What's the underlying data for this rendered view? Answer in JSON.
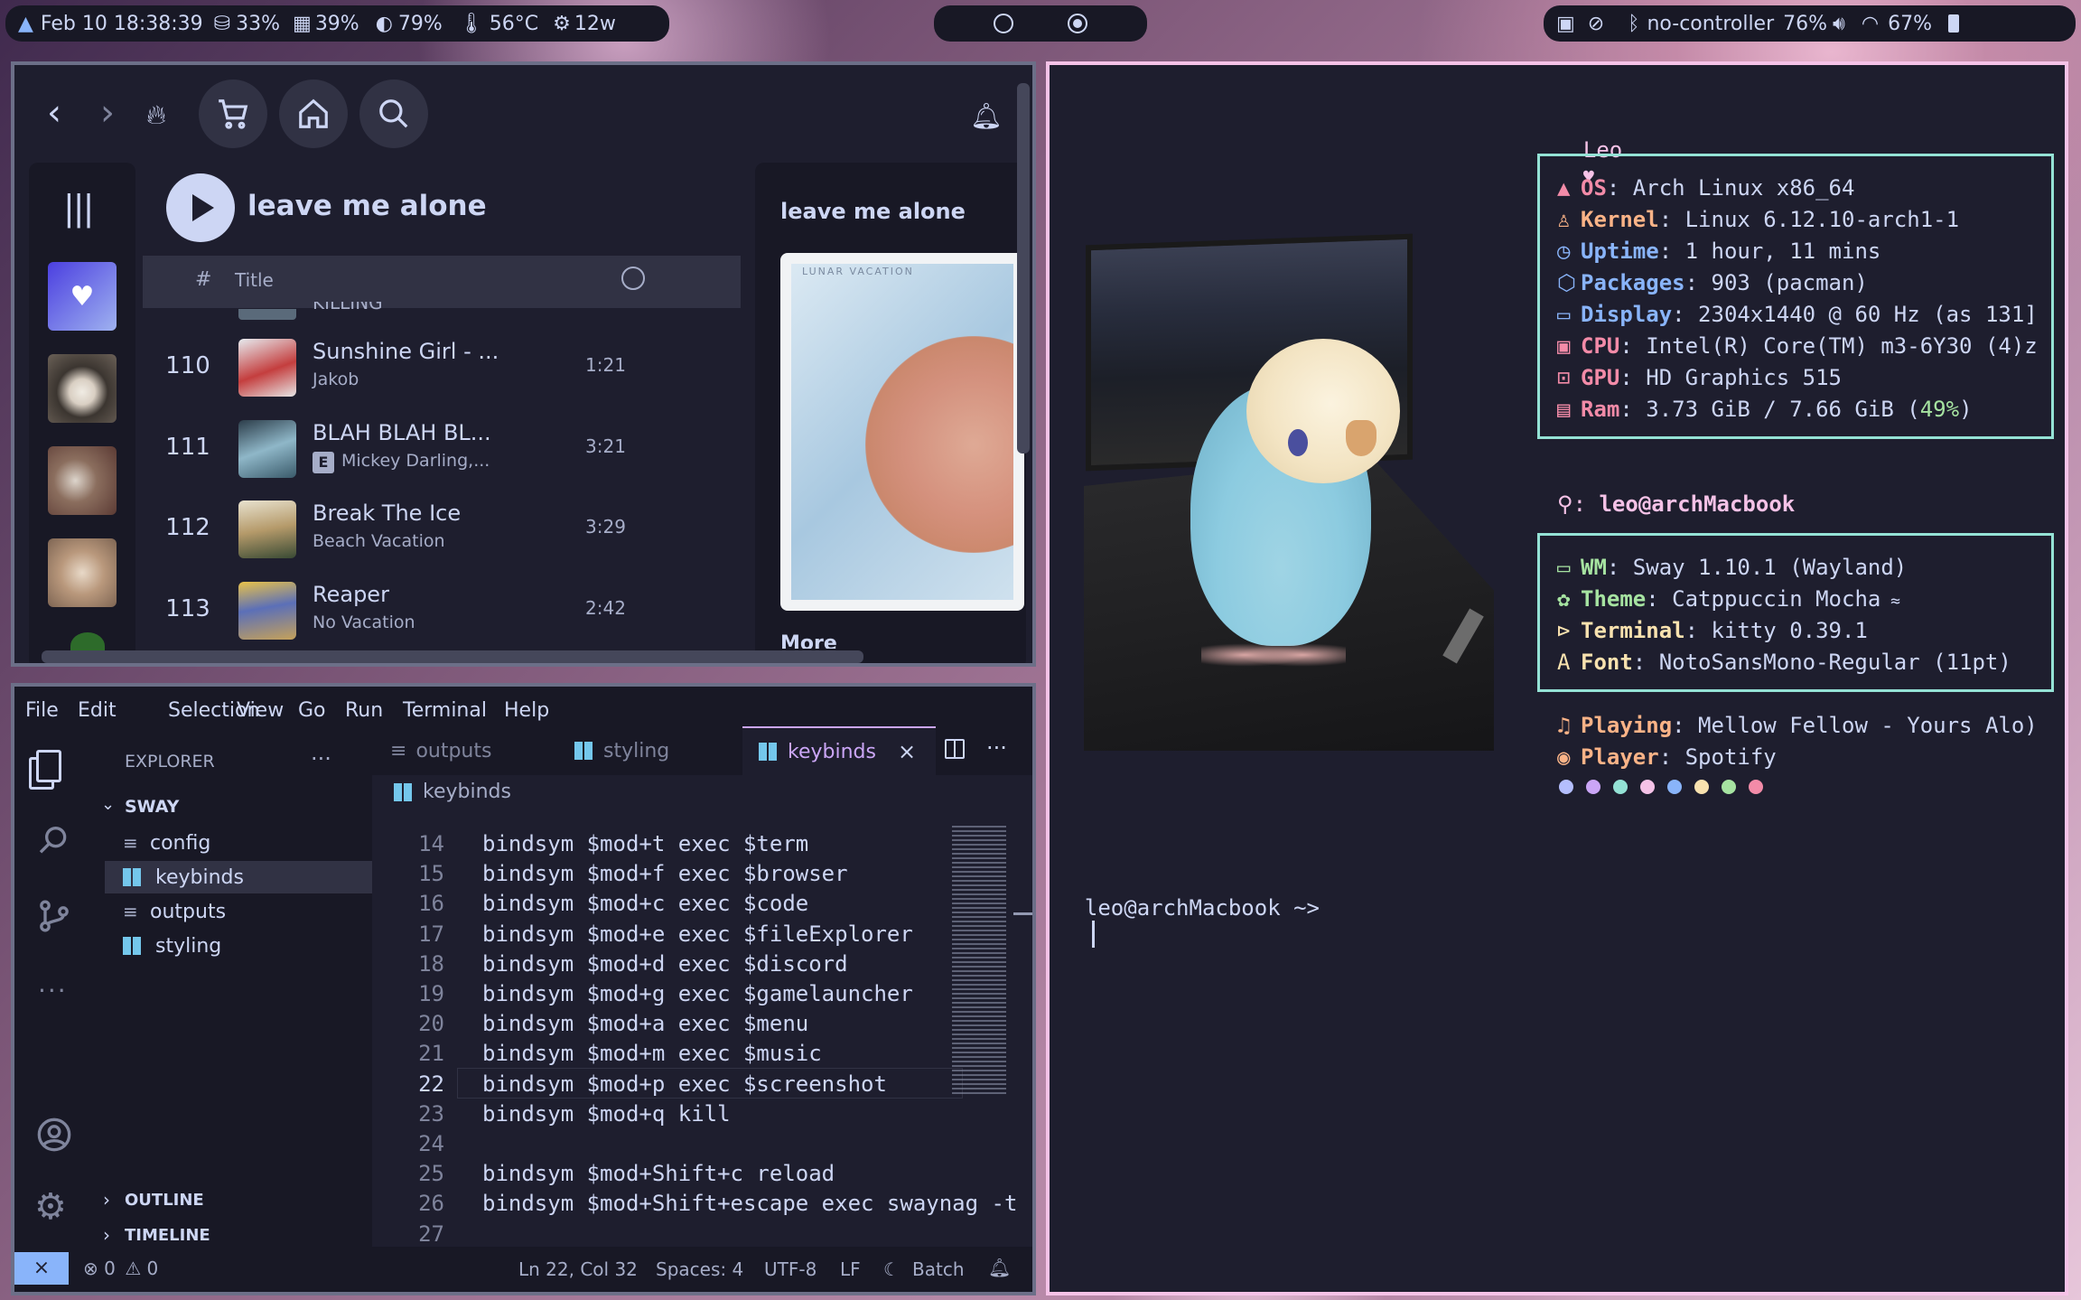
{
  "statusbar": {
    "datetime": "Feb 10 18:38:39",
    "disk": "33%",
    "memory": "39%",
    "brightness": "79%",
    "temp": "56°C",
    "power": "12w",
    "controller": "no-controller",
    "volume": "76%",
    "wifi": "67%"
  },
  "spotify": {
    "playlist_title": "leave me alone",
    "col_num": "#",
    "col_title": "Title",
    "partial_row_text": "KILLING",
    "rows": [
      {
        "num": "110",
        "title": "Sunshine Girl - ...",
        "artist": "Jakob",
        "duration": "1:21"
      },
      {
        "num": "111",
        "title": "BLAH BLAH BL...",
        "artist": "Mickey Darling,...",
        "explicit": "E",
        "duration": "3:21"
      },
      {
        "num": "112",
        "title": "Break The Ice",
        "artist": "Beach Vacation",
        "duration": "3:29"
      },
      {
        "num": "113",
        "title": "Reaper",
        "artist": "No Vacation",
        "duration": "2:42"
      }
    ],
    "side_title": "leave me alone",
    "cover_text": "LUNAR VACATION",
    "side_more": "More"
  },
  "vscode": {
    "menu": [
      "File",
      "Edit",
      "Selection",
      "View",
      "Go",
      "Run",
      "Terminal",
      "Help"
    ],
    "explorer_label": "EXPLORER",
    "folder": "SWAY",
    "files": [
      "config",
      "keybinds",
      "outputs",
      "styling"
    ],
    "outline": "OUTLINE",
    "timeline": "TIMELINE",
    "tabs": [
      "outputs",
      "styling",
      "keybinds"
    ],
    "breadcrumb": "keybinds",
    "lines": [
      {
        "n": "14",
        "t": "bindsym $mod+t exec $term"
      },
      {
        "n": "15",
        "t": "bindsym $mod+f exec $browser"
      },
      {
        "n": "16",
        "t": "bindsym $mod+c exec $code"
      },
      {
        "n": "17",
        "t": "bindsym $mod+e exec $fileExplorer"
      },
      {
        "n": "18",
        "t": "bindsym $mod+d exec $discord"
      },
      {
        "n": "19",
        "t": "bindsym $mod+g exec $gamelauncher"
      },
      {
        "n": "20",
        "t": "bindsym $mod+a exec $menu"
      },
      {
        "n": "21",
        "t": "bindsym $mod+m exec $music"
      },
      {
        "n": "22",
        "t": "bindsym $mod+p exec $screenshot"
      },
      {
        "n": "23",
        "t": "bindsym $mod+q kill"
      },
      {
        "n": "24",
        "t": ""
      },
      {
        "n": "25",
        "t": "bindsym $mod+Shift+c reload"
      },
      {
        "n": "26",
        "t": "bindsym $mod+Shift+escape exec swaynag -t"
      },
      {
        "n": "27",
        "t": ""
      }
    ],
    "status": {
      "errors": "0",
      "warnings": "0",
      "position": "Ln 22, Col 32",
      "spaces": "Spaces: 4",
      "encoding": "UTF-8",
      "eol": "LF",
      "language": "Batch"
    }
  },
  "terminal": {
    "header_name": "Leo",
    "info1": [
      {
        "key": "OS",
        "val": ": Arch Linux x86_64"
      },
      {
        "key": "Kernel",
        "val": ": Linux 6.12.10-arch1-1"
      },
      {
        "key": "Uptime",
        "val": ": 1 hour, 11 mins"
      },
      {
        "key": "Packages",
        "val": ": 903 (pacman)"
      },
      {
        "key": "Display",
        "val": ": 2304x1440 @ 60 Hz (as 131]"
      },
      {
        "key": "CPU",
        "val": ": Intel(R) Core(TM) m3-6Y30 (4)z"
      },
      {
        "key": "GPU",
        "val": ": HD Graphics 515"
      },
      {
        "key": "Ram",
        "val": ": 3.73 GiB / 7.66 GiB (",
        "pct": "49%",
        "tail": ")"
      }
    ],
    "userline": "leo@archMacbook",
    "info2": [
      {
        "key": "WM",
        "val": ": Sway 1.10.1 (Wayland)"
      },
      {
        "key": "Theme",
        "val": ": Catppuccin Mocha"
      },
      {
        "key": "Terminal",
        "val": ": kitty 0.39.1"
      },
      {
        "key": "Font",
        "val": ": NotoSansMono-Regular (11pt)"
      }
    ],
    "info3": [
      {
        "key": "Playing",
        "val": ": Mellow Fellow - Yours Alo)"
      },
      {
        "key": "Player",
        "val": ": Spotify"
      }
    ],
    "dot_colors": [
      "#b4befe",
      "#cba6f7",
      "#94e2d5",
      "#f5c2e7",
      "#89b4fa",
      "#f9e2af",
      "#a6e3a1",
      "#f38ba8"
    ],
    "prompt": "leo@archMacbook ~>"
  }
}
